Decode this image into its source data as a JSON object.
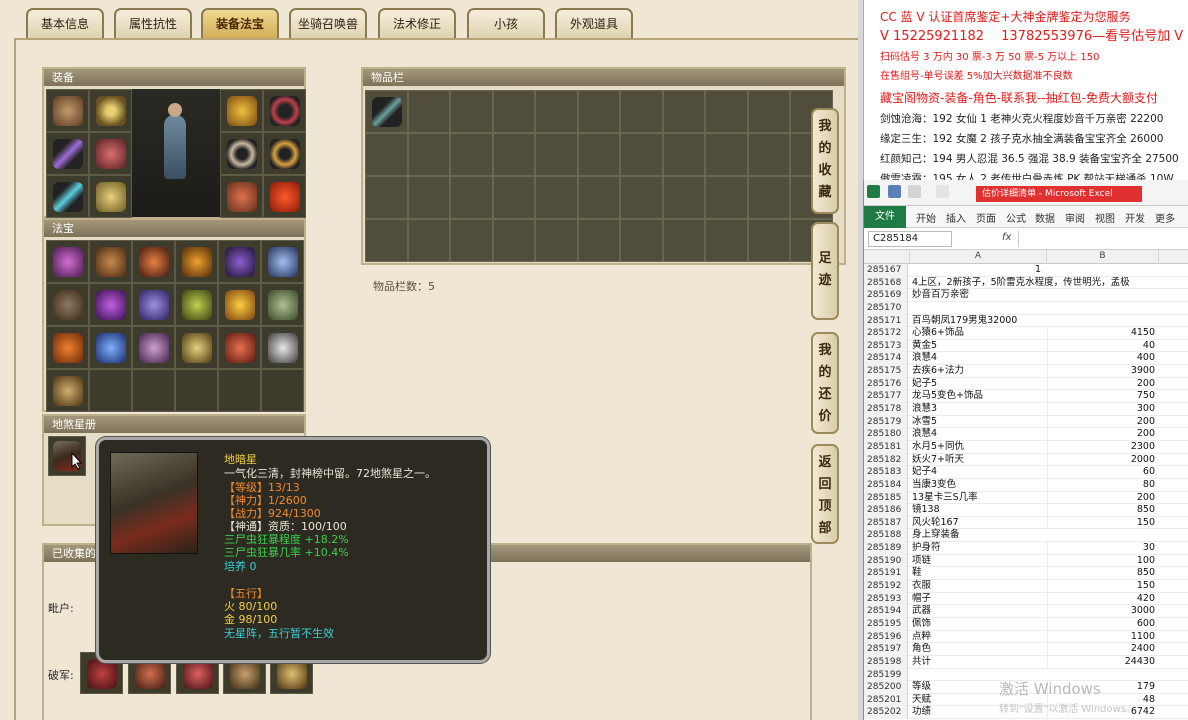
{
  "game": {
    "tabs": [
      "基本信息",
      "属性抗性",
      "装备法宝",
      "坐骑召唤兽",
      "法术修正",
      "小孩",
      "外观道具"
    ],
    "active_tab": "装备法宝",
    "equipment_title": "装备",
    "fabao_title": "法宝",
    "disha_title": "地煞星册",
    "inventory_title": "物品栏",
    "inventory_count_label": "物品栏数：5",
    "collected_title": "已收集的",
    "row_label_1": "毗户:",
    "row_label_2": "破军:",
    "side_buttons": [
      {
        "label": [
          "我",
          "的",
          "收",
          "藏"
        ]
      },
      {
        "label": [
          "足",
          "迹"
        ]
      },
      {
        "label": [
          "我",
          "的",
          "还",
          "价"
        ]
      },
      {
        "label": [
          "返",
          "回",
          "顶",
          "部"
        ]
      }
    ],
    "tooltip": {
      "name": "地暗星",
      "desc": "一气化三清，封神榜中留。72地煞星之一。",
      "level": "【等级】13/13",
      "shenli": "【神力】1/2600",
      "zhanli": "【战力】924/1300",
      "shentong": "【神通】资质：100/100",
      "bonus1": "三尸虫狂暴程度 +18.2%",
      "bonus2": "三尸虫狂暴几率 +10.4%",
      "peiyang": "培养 0",
      "wuxing_title": "【五行】",
      "fire": "火 80/100",
      "metal": "金 98/100",
      "formation": "无星阵，五行暂不生效"
    }
  },
  "ads": {
    "line1": "CC 蓝 V 认证首席鉴定+大神金牌鉴定为您服务",
    "line2": "V 15225921182　 13782553976—看号估号加 V",
    "line3": "扫码估号 3 万内 30 票-3 万 50 票-5 万以上 150",
    "line4": "在售组号-单号误差 5%加大兴数据准不良数",
    "line5": "藏宝阁物资-装备-角色-联系我--抽红包-免费大额支付",
    "line6": "剑蚀沧海：192 女仙 1 老神火克火程度妙音千万亲密 22200",
    "line7": "缘定三生：192 女魔 2 孩子克水抽全满装备宝宝齐全 26000",
    "line8": "红颜知己：194 男人忍混 36.5 强混 38.9 装备宝宝齐全 27500",
    "line9": "傲雪凌霜：195 女人 2 老传世白骨赤炼 PK 帮站天梯通杀 10W"
  },
  "excel": {
    "window_title": "估价详细清单 - Microsoft Excel",
    "menu": [
      "文件",
      "开始",
      "插入",
      "页面",
      "公式",
      "数据",
      "审阅",
      "视图",
      "开发",
      "更多"
    ],
    "name_box": "C285184",
    "fx": "fx",
    "col_a": "A",
    "col_b": "B",
    "rows": [
      {
        "n": "285167",
        "a": "",
        "b": "1"
      },
      {
        "n": "285168",
        "a": "4上区，2新孩子，5阶雷克水程度，传世明光，孟极",
        "b": ""
      },
      {
        "n": "285169",
        "a": "妙音百万亲密",
        "b": ""
      },
      {
        "n": "285170",
        "a": "",
        "b": ""
      },
      {
        "n": "285171",
        "a": "百鸟朝凤179男鬼32000",
        "b": ""
      },
      {
        "n": "285172",
        "a": "心猿6+饰品",
        "b": "4150"
      },
      {
        "n": "285173",
        "a": "黄金5",
        "b": "40"
      },
      {
        "n": "285174",
        "a": "浪慧4",
        "b": "400"
      },
      {
        "n": "285175",
        "a": "去疾6+法力",
        "b": "3900"
      },
      {
        "n": "285176",
        "a": "妃子5",
        "b": "200"
      },
      {
        "n": "285177",
        "a": "龙马5变色+饰品",
        "b": "750"
      },
      {
        "n": "285178",
        "a": "浪慧3",
        "b": "300"
      },
      {
        "n": "285179",
        "a": "冰雪5",
        "b": "200"
      },
      {
        "n": "285180",
        "a": "浪慧4",
        "b": "200"
      },
      {
        "n": "285181",
        "a": "水月5+同仇",
        "b": "2300"
      },
      {
        "n": "285182",
        "a": "妖火7+听天",
        "b": "2000"
      },
      {
        "n": "285183",
        "a": "妃子4",
        "b": "60"
      },
      {
        "n": "285184",
        "a": "当康3变色",
        "b": "80"
      },
      {
        "n": "285185",
        "a": "13星卡三S几率",
        "b": "200"
      },
      {
        "n": "285186",
        "a": "镜138",
        "b": "850"
      },
      {
        "n": "285187",
        "a": "风火轮167",
        "b": "150"
      },
      {
        "n": "285188",
        "a": "身上穿装备",
        "b": ""
      },
      {
        "n": "285189",
        "a": "护身符",
        "b": "30"
      },
      {
        "n": "285190",
        "a": "项链",
        "b": "100"
      },
      {
        "n": "285191",
        "a": "鞋",
        "b": "850"
      },
      {
        "n": "285192",
        "a": "衣服",
        "b": "150"
      },
      {
        "n": "285193",
        "a": "帽子",
        "b": "420"
      },
      {
        "n": "285194",
        "a": "武器",
        "b": "3000"
      },
      {
        "n": "285195",
        "a": "佩饰",
        "b": "600"
      },
      {
        "n": "285196",
        "a": "点粹",
        "b": "1100"
      },
      {
        "n": "285197",
        "a": "角色",
        "b": "2400"
      },
      {
        "n": "285198",
        "a": "共计",
        "b": "24430"
      },
      {
        "n": "285199",
        "a": "",
        "b": ""
      },
      {
        "n": "285200",
        "a": "等级",
        "b": "179"
      },
      {
        "n": "285201",
        "a": "天赋",
        "b": "48"
      },
      {
        "n": "285202",
        "a": "功绩",
        "b": "6742"
      }
    ],
    "watermark": "激活 Windows",
    "watermark_sub": "转到\"设置\"以激活 Windows。"
  }
}
